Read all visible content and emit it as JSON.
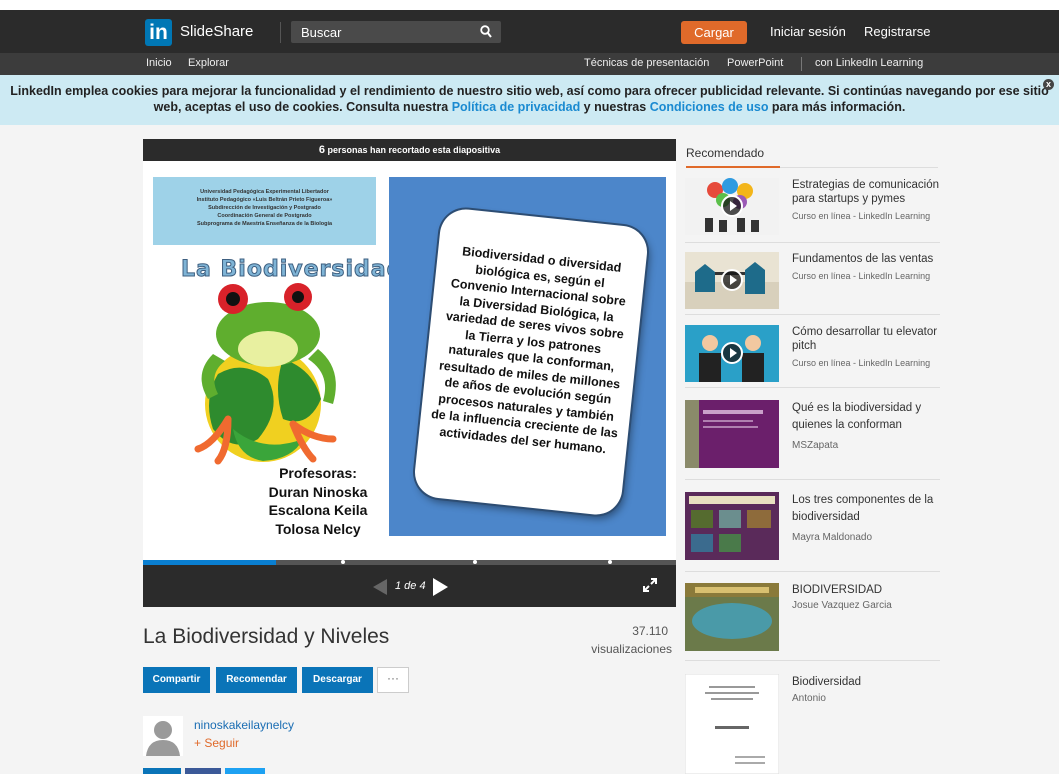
{
  "header": {
    "logo_mark": "in",
    "brand": "SlideShare",
    "search_placeholder": "Buscar",
    "upload_label": "Cargar",
    "login_label": "Iniciar sesión",
    "signup_label": "Registrarse"
  },
  "subnav": {
    "home": "Inicio",
    "explore": "Explorar",
    "techniques": "Técnicas de presentación",
    "powerpoint": "PowerPoint",
    "learning": "con LinkedIn Learning"
  },
  "cookie": {
    "text_1": "LinkedIn emplea cookies para mejorar la funcionalidad y el rendimiento de nuestro sitio web, así como para ofrecer publicidad relevante. Si continúas navegando por ese sitio web, aceptas el uso de cookies. Consulta nuestra ",
    "privacy_link": "Política de privacidad",
    "text_2": " y nuestras ",
    "terms_link": "Condiciones de uso",
    "text_3": " para más información.",
    "close": "x"
  },
  "player": {
    "clipped_count": "6",
    "clipped_text": " personas han recortado esta diapositiva",
    "page_indicator": "1 de 4",
    "progress_fraction": 0.25
  },
  "slide": {
    "header_lines": [
      "Universidad Pedagógica Experimental Libertador",
      "Instituto Pedagógico «Luis Beltrán Prieto Figueroa»",
      "Subdirección de Investigación y Postgrado",
      "Coordinación General de Postgrado",
      "Subprograma de Maestría Enseñanza de la Biología"
    ],
    "title": "La Biodiversidad",
    "profs_label": "Profesoras:",
    "profs": [
      "Duran Ninoska",
      "Escalona Keila",
      "Tolosa Nelcy"
    ],
    "card_text": "Biodiversidad o diversidad biológica es, según el Convenio Internacional sobre la Diversidad Biológica, la variedad de seres vivos sobre la Tierra y los patrones naturales que la conforman, resultado de miles de millones de años de evolución según procesos naturales y también de la influencia creciente de las actividades del ser humano."
  },
  "document": {
    "title": "La Biodiversidad y Niveles",
    "views_count": "37.110",
    "views_label": "visualizaciones",
    "share_label": "Compartir",
    "recommend_label": "Recomendar",
    "download_label": "Descargar",
    "more_label": "···",
    "author": "ninoskakeilaynelcy",
    "follow_label": "+ Seguir"
  },
  "sidebar": {
    "tab_label": "Recomendado",
    "items": [
      {
        "title": "Estrategias de comunicación para startups y pymes",
        "subtitle": "Curso en línea - LinkedIn Learning"
      },
      {
        "title": "Fundamentos de las ventas",
        "subtitle": "Curso en línea - LinkedIn Learning"
      },
      {
        "title": "Cómo desarrollar tu elevator pitch",
        "subtitle": "Curso en línea - LinkedIn Learning"
      },
      {
        "title": "Qué es la biodiversidad y quienes la conforman",
        "subtitle": "MSZapata"
      },
      {
        "title": "Los tres componentes de la biodiversidad",
        "subtitle": "Mayra Maldonado"
      },
      {
        "title": "BIODIVERSIDAD",
        "subtitle": "Josue Vazquez Garcia"
      },
      {
        "title": "Biodiversidad",
        "subtitle": "Antonio"
      }
    ]
  }
}
